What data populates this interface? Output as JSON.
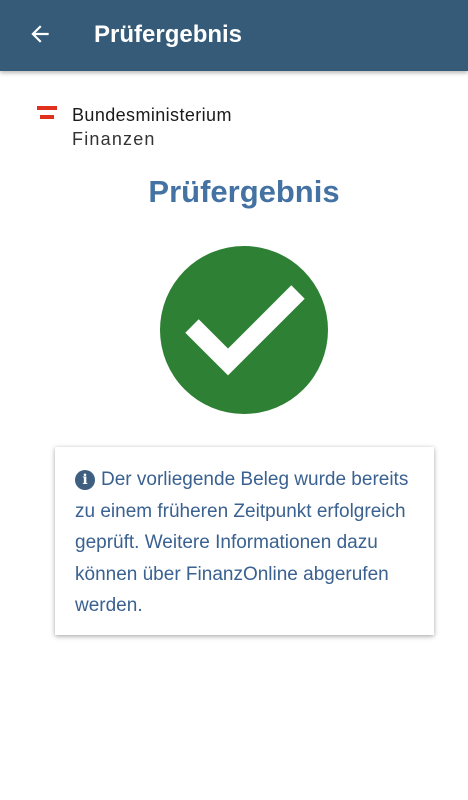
{
  "app_bar": {
    "title": "Prüfergebnis",
    "back_icon": "arrow-left-icon",
    "color": "#355b78"
  },
  "logo": {
    "line1": "Bundesministerium",
    "line2": "Finanzen",
    "flag_colors": [
      "#e0301e",
      "#ffffff",
      "#e0301e"
    ]
  },
  "main": {
    "title": "Prüfergebnis",
    "status_icon": "check-icon",
    "status_color": "#2d8034",
    "info_icon": "info-icon",
    "info_text": "Der vorliegende Beleg wurde bereits zu einem früheren Zeitpunkt erfolgreich geprüft. Weitere Informationen dazu können über FinanzOnline abgerufen werden."
  }
}
